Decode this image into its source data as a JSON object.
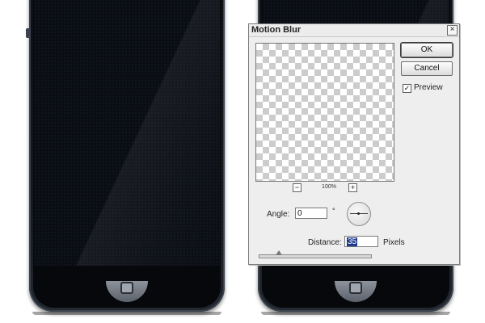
{
  "dialog": {
    "title": "Motion Blur",
    "close_glyph": "×",
    "ok_label": "OK",
    "cancel_label": "Cancel",
    "preview_label": "Preview",
    "preview_checked": true,
    "preview_check_glyph": "✓",
    "zoom": {
      "out_glyph": "−",
      "in_glyph": "+",
      "value": "100%"
    },
    "angle": {
      "label": "Angle:",
      "value": "0",
      "unit": "°"
    },
    "distance": {
      "label": "Distance:",
      "value": "35",
      "unit": "Pixels",
      "slider_fraction": 0.18
    }
  },
  "colors": {
    "dialog_bg": "#eeeeee",
    "phone_body": "#0c0e12",
    "selection": "#1f3b8c"
  },
  "icons": {
    "close": "close-icon",
    "zoom_out": "minus-icon",
    "zoom_in": "plus-icon",
    "check": "checkmark-icon",
    "dial": "angle-dial-icon"
  }
}
